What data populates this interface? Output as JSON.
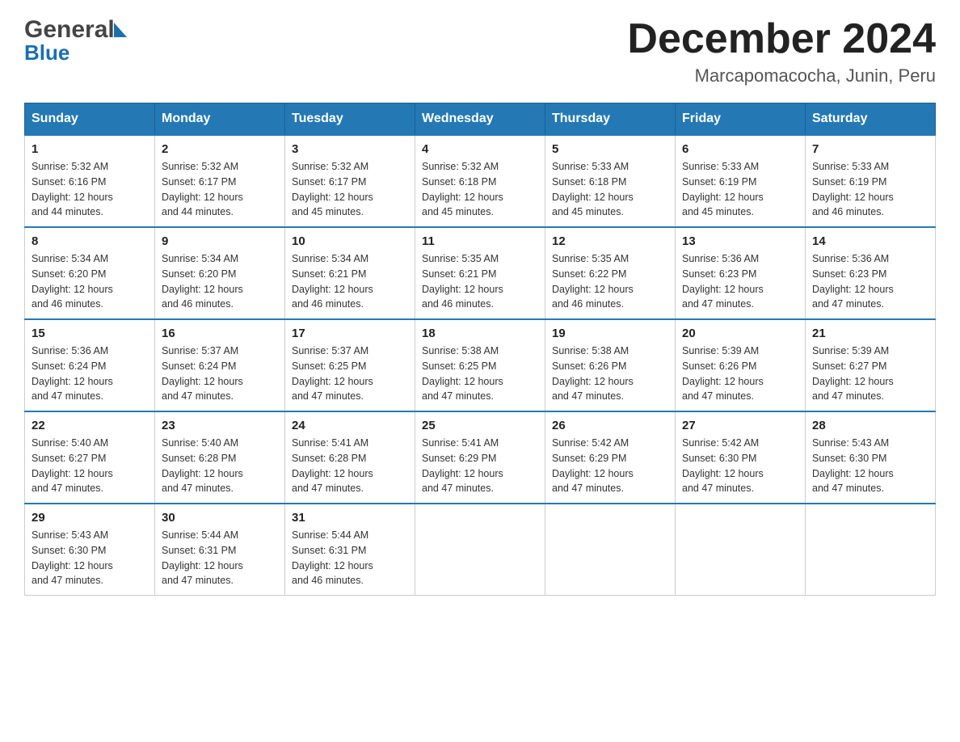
{
  "header": {
    "logo_part1": "General",
    "logo_part2": "Blue",
    "month_title": "December 2024",
    "location": "Marcapomacocha, Junin, Peru"
  },
  "days_of_week": [
    "Sunday",
    "Monday",
    "Tuesday",
    "Wednesday",
    "Thursday",
    "Friday",
    "Saturday"
  ],
  "weeks": [
    [
      {
        "day": "1",
        "sunrise": "5:32 AM",
        "sunset": "6:16 PM",
        "daylight": "12 hours and 44 minutes."
      },
      {
        "day": "2",
        "sunrise": "5:32 AM",
        "sunset": "6:17 PM",
        "daylight": "12 hours and 44 minutes."
      },
      {
        "day": "3",
        "sunrise": "5:32 AM",
        "sunset": "6:17 PM",
        "daylight": "12 hours and 45 minutes."
      },
      {
        "day": "4",
        "sunrise": "5:32 AM",
        "sunset": "6:18 PM",
        "daylight": "12 hours and 45 minutes."
      },
      {
        "day": "5",
        "sunrise": "5:33 AM",
        "sunset": "6:18 PM",
        "daylight": "12 hours and 45 minutes."
      },
      {
        "day": "6",
        "sunrise": "5:33 AM",
        "sunset": "6:19 PM",
        "daylight": "12 hours and 45 minutes."
      },
      {
        "day": "7",
        "sunrise": "5:33 AM",
        "sunset": "6:19 PM",
        "daylight": "12 hours and 46 minutes."
      }
    ],
    [
      {
        "day": "8",
        "sunrise": "5:34 AM",
        "sunset": "6:20 PM",
        "daylight": "12 hours and 46 minutes."
      },
      {
        "day": "9",
        "sunrise": "5:34 AM",
        "sunset": "6:20 PM",
        "daylight": "12 hours and 46 minutes."
      },
      {
        "day": "10",
        "sunrise": "5:34 AM",
        "sunset": "6:21 PM",
        "daylight": "12 hours and 46 minutes."
      },
      {
        "day": "11",
        "sunrise": "5:35 AM",
        "sunset": "6:21 PM",
        "daylight": "12 hours and 46 minutes."
      },
      {
        "day": "12",
        "sunrise": "5:35 AM",
        "sunset": "6:22 PM",
        "daylight": "12 hours and 46 minutes."
      },
      {
        "day": "13",
        "sunrise": "5:36 AM",
        "sunset": "6:23 PM",
        "daylight": "12 hours and 47 minutes."
      },
      {
        "day": "14",
        "sunrise": "5:36 AM",
        "sunset": "6:23 PM",
        "daylight": "12 hours and 47 minutes."
      }
    ],
    [
      {
        "day": "15",
        "sunrise": "5:36 AM",
        "sunset": "6:24 PM",
        "daylight": "12 hours and 47 minutes."
      },
      {
        "day": "16",
        "sunrise": "5:37 AM",
        "sunset": "6:24 PM",
        "daylight": "12 hours and 47 minutes."
      },
      {
        "day": "17",
        "sunrise": "5:37 AM",
        "sunset": "6:25 PM",
        "daylight": "12 hours and 47 minutes."
      },
      {
        "day": "18",
        "sunrise": "5:38 AM",
        "sunset": "6:25 PM",
        "daylight": "12 hours and 47 minutes."
      },
      {
        "day": "19",
        "sunrise": "5:38 AM",
        "sunset": "6:26 PM",
        "daylight": "12 hours and 47 minutes."
      },
      {
        "day": "20",
        "sunrise": "5:39 AM",
        "sunset": "6:26 PM",
        "daylight": "12 hours and 47 minutes."
      },
      {
        "day": "21",
        "sunrise": "5:39 AM",
        "sunset": "6:27 PM",
        "daylight": "12 hours and 47 minutes."
      }
    ],
    [
      {
        "day": "22",
        "sunrise": "5:40 AM",
        "sunset": "6:27 PM",
        "daylight": "12 hours and 47 minutes."
      },
      {
        "day": "23",
        "sunrise": "5:40 AM",
        "sunset": "6:28 PM",
        "daylight": "12 hours and 47 minutes."
      },
      {
        "day": "24",
        "sunrise": "5:41 AM",
        "sunset": "6:28 PM",
        "daylight": "12 hours and 47 minutes."
      },
      {
        "day": "25",
        "sunrise": "5:41 AM",
        "sunset": "6:29 PM",
        "daylight": "12 hours and 47 minutes."
      },
      {
        "day": "26",
        "sunrise": "5:42 AM",
        "sunset": "6:29 PM",
        "daylight": "12 hours and 47 minutes."
      },
      {
        "day": "27",
        "sunrise": "5:42 AM",
        "sunset": "6:30 PM",
        "daylight": "12 hours and 47 minutes."
      },
      {
        "day": "28",
        "sunrise": "5:43 AM",
        "sunset": "6:30 PM",
        "daylight": "12 hours and 47 minutes."
      }
    ],
    [
      {
        "day": "29",
        "sunrise": "5:43 AM",
        "sunset": "6:30 PM",
        "daylight": "12 hours and 47 minutes."
      },
      {
        "day": "30",
        "sunrise": "5:44 AM",
        "sunset": "6:31 PM",
        "daylight": "12 hours and 47 minutes."
      },
      {
        "day": "31",
        "sunrise": "5:44 AM",
        "sunset": "6:31 PM",
        "daylight": "12 hours and 46 minutes."
      },
      null,
      null,
      null,
      null
    ]
  ],
  "labels": {
    "sunrise": "Sunrise:",
    "sunset": "Sunset:",
    "daylight": "Daylight:"
  }
}
